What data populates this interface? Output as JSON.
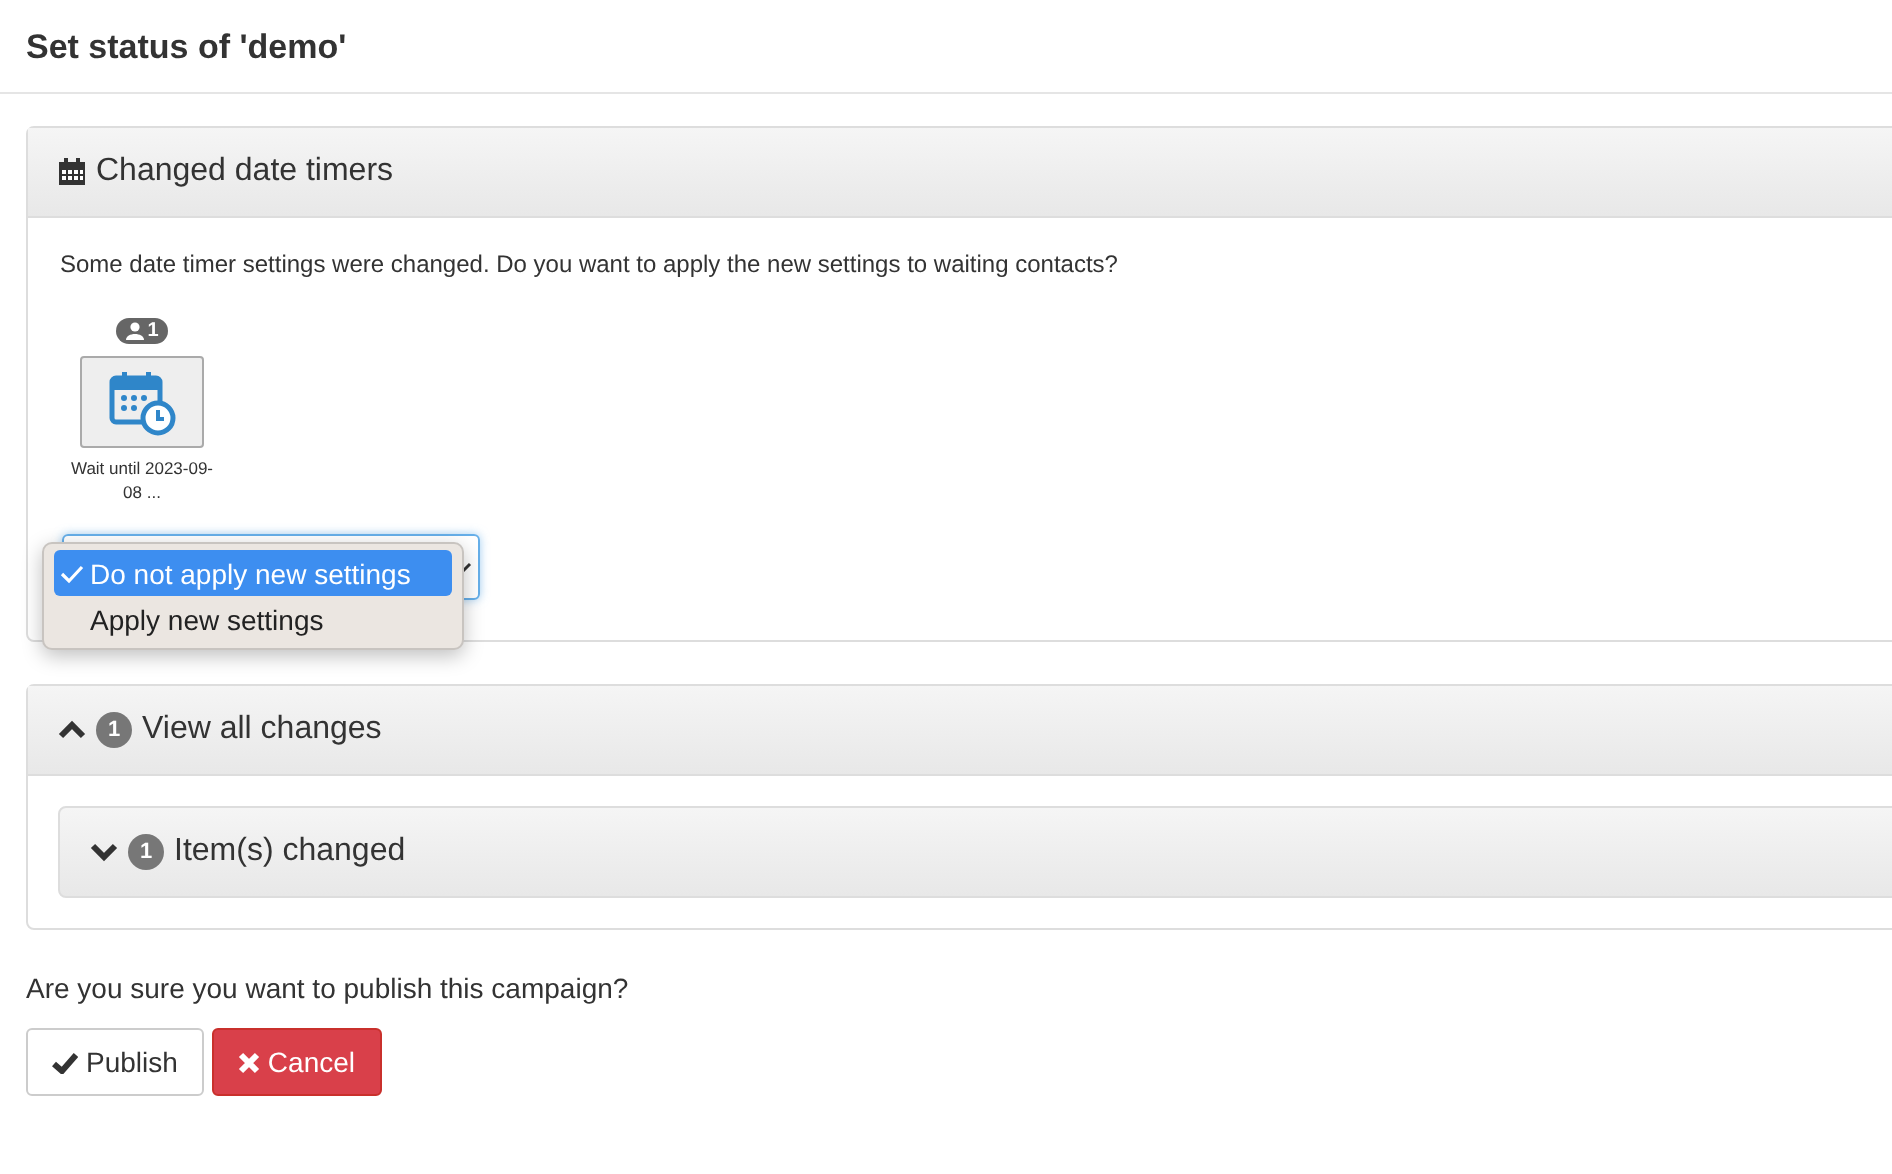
{
  "page_title": "Set status of 'demo'",
  "timers_panel": {
    "title": "Changed date timers",
    "message": "Some date timer settings were changed. Do you want to apply the new settings to waiting contacts?",
    "timer": {
      "contacts": "1",
      "label": "Wait until 2023-09-08 ..."
    },
    "dropdown": {
      "open": true,
      "options": [
        {
          "label": "Do not apply new settings",
          "selected": true
        },
        {
          "label": "Apply new settings",
          "selected": false
        }
      ]
    }
  },
  "changes_panel": {
    "title": "View all changes",
    "count": "1",
    "expanded": true,
    "children": [
      {
        "title": "Item(s) changed",
        "count": "1",
        "expanded": false
      }
    ]
  },
  "question": "Are you sure you want to publish this campaign?",
  "buttons": [
    {
      "label": "Publish",
      "kind": "default"
    },
    {
      "label": "Cancel",
      "kind": "danger"
    }
  ]
}
